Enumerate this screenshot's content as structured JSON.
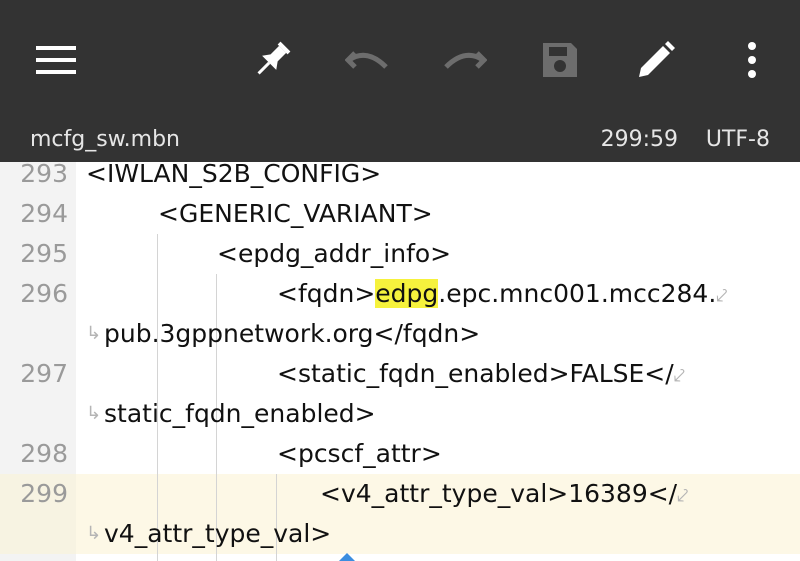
{
  "toolbar": {
    "icons": [
      "menu-icon",
      "pin-icon",
      "undo-icon",
      "redo-icon",
      "save-icon",
      "edit-icon",
      "more-vertical-icon"
    ],
    "accent": "#333333"
  },
  "status": {
    "filename": "mcfg_sw.mbn",
    "position": "299:59",
    "encoding": "UTF-8"
  },
  "editor": {
    "highlight_color": "#fdf8e6",
    "find_highlight_color": "#f6f23d",
    "lines": [
      {
        "num": "293",
        "rows": [
          "<IWLAN_S2B_CONFIG>"
        ]
      },
      {
        "num": "294",
        "rows": [
          "<GENERIC_VARIANT>"
        ]
      },
      {
        "num": "295",
        "rows": [
          "<epdg_addr_info>"
        ]
      },
      {
        "num": "296",
        "rows": [
          "<fqdn>",
          "edpg",
          ".epc.mnc001.mcc284.",
          "pub.3gppnetwork.org</fqdn>"
        ]
      },
      {
        "num": "297",
        "rows": [
          "<static_fqdn_enabled>FALSE</",
          "static_fqdn_enabled>"
        ]
      },
      {
        "num": "298",
        "rows": [
          "<pcscf_attr>"
        ]
      },
      {
        "num": "299",
        "rows": [
          "<v4_attr_type_val>16389</",
          "v4_attr_type_val>"
        ]
      }
    ]
  }
}
